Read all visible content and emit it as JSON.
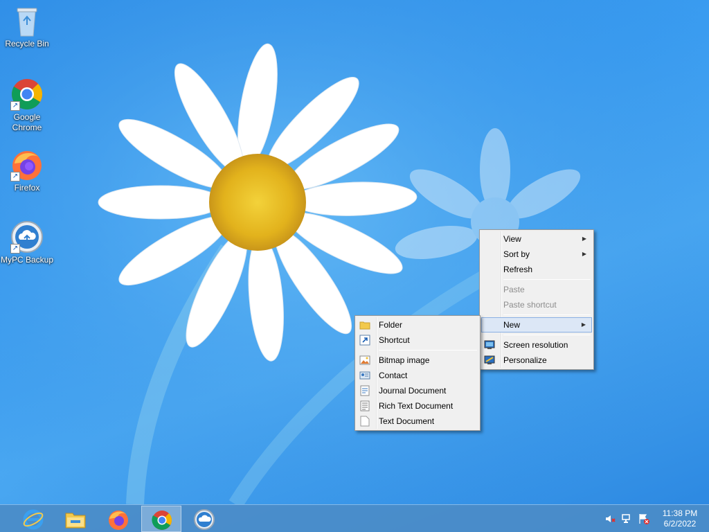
{
  "desktop": {
    "icons": [
      {
        "label": "Recycle Bin",
        "icon": "recycle-bin-icon"
      },
      {
        "label": "Google Chrome",
        "icon": "chrome-icon"
      },
      {
        "label": "Firefox",
        "icon": "firefox-icon"
      },
      {
        "label": "MyPC Backup",
        "icon": "mypc-backup-icon"
      }
    ]
  },
  "context_menu": {
    "items": [
      {
        "label": "View",
        "submenu": true
      },
      {
        "label": "Sort by",
        "submenu": true
      },
      {
        "label": "Refresh"
      },
      {
        "label": "Paste",
        "disabled": true
      },
      {
        "label": "Paste shortcut",
        "disabled": true
      },
      {
        "label": "New",
        "submenu": true,
        "highlighted": true
      },
      {
        "label": "Screen resolution",
        "icon": "screen-resolution-icon"
      },
      {
        "label": "Personalize",
        "icon": "personalize-icon"
      }
    ]
  },
  "new_submenu": {
    "items": [
      {
        "label": "Folder",
        "icon": "folder-icon"
      },
      {
        "label": "Shortcut",
        "icon": "shortcut-icon"
      },
      {
        "label": "Bitmap image",
        "icon": "bitmap-icon"
      },
      {
        "label": "Contact",
        "icon": "contact-icon"
      },
      {
        "label": "Journal Document",
        "icon": "journal-icon"
      },
      {
        "label": "Rich Text Document",
        "icon": "rich-text-icon"
      },
      {
        "label": "Text Document",
        "icon": "text-document-icon"
      }
    ]
  },
  "taskbar": {
    "apps": [
      {
        "name": "Internet Explorer",
        "icon": "internet-explorer-icon"
      },
      {
        "name": "File Explorer",
        "icon": "file-explorer-icon"
      },
      {
        "name": "Firefox",
        "icon": "firefox-icon"
      },
      {
        "name": "Google Chrome",
        "icon": "chrome-icon",
        "active": true
      },
      {
        "name": "MyPC Backup",
        "icon": "mypc-backup-icon"
      }
    ],
    "tray": [
      "volume-muted-icon",
      "network-icon",
      "action-center-icon"
    ],
    "clock": {
      "time": "11:38 PM",
      "date": "6/2/2022"
    }
  },
  "colors": {
    "desktop_bg": "#3a9cf0",
    "menu_bg": "#f0f0f0",
    "menu_highlight": "#dce7f6",
    "taskbar_bg": "#4b8cc8"
  }
}
